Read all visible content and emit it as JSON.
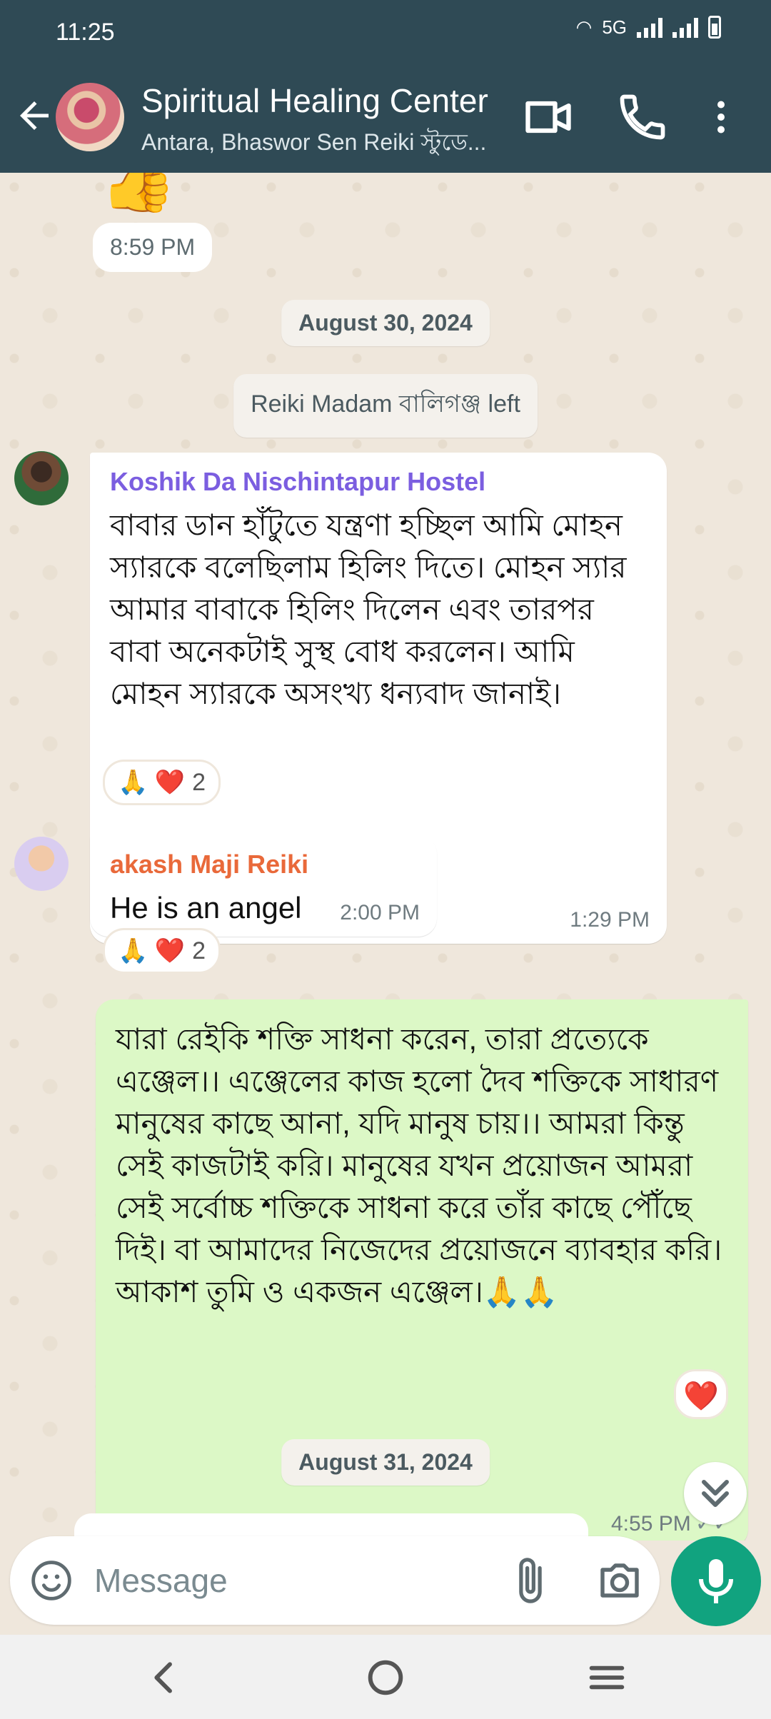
{
  "status_bar": {
    "time": "11:25",
    "network": "5G"
  },
  "header": {
    "title": "Spiritual Healing Center",
    "subtitle": "Antara, Bhaswor Sen Reiki স্টুডে..."
  },
  "chat": {
    "prev_message_time": "8:59 PM",
    "date_1": "August 30, 2024",
    "system_event": "Reiki Madam বালিগঞ্জ left",
    "messages": [
      {
        "sender": "Koshik Da Nischintapur Hostel",
        "text": "বাবার ডান হাঁটুতে যন্ত্রণা হচ্ছিল আমি মোহন স্যারকে বলেছিলাম  হিলিং দিতে। মোহন স্যার আমার  বাবাকে হিলিং দিলেন এবং তারপর বাবা অনেকটাই সুস্থ বোধ করলেন। আমি মোহন স্যারকে অসংখ্য ধন্যবাদ জানাই।",
        "time": "1:29 PM",
        "reactions": "🙏 ❤️",
        "reaction_count": "2"
      },
      {
        "sender": "akash Maji Reiki",
        "text": "He is an angel",
        "time": "2:00 PM",
        "reactions": "🙏 ❤️",
        "reaction_count": "2"
      },
      {
        "text": "যারা রেইকি শক্তি সাধনা করেন, তারা প্রত্যেকে এঞ্জেল।। এঞ্জেলের কাজ হলো দৈব শক্তিকে সাধারণ মানুষের কাছে আনা, যদি মানুষ চায়।। আমরা কিন্তু সেই কাজটাই করি। মানুষের যখন প্রয়োজন আমরা সেই সর্বোচ্চ শক্তিকে সাধনা করে তাঁর কাছে পৌঁছে দিই। বা আমাদের নিজেদের প্রয়োজনে ব্যাবহার করি। আকাশ তুমি ও একজন এঞ্জেল।🙏🙏",
        "time": "4:55 PM",
        "reaction": "❤️"
      }
    ],
    "date_2": "August 31, 2024"
  },
  "composer": {
    "placeholder": "Message"
  },
  "icons": {
    "back": "arrow-left",
    "video": "video-camera",
    "call": "phone",
    "more": "vertical-dots",
    "emoji": "smiley",
    "attach": "paperclip",
    "camera": "camera",
    "mic": "microphone",
    "scroll": "double-chevron-down"
  },
  "colors": {
    "header": "#2f4a55",
    "outgoing_bubble": "#dcf8c6",
    "mic_button": "#11a37f",
    "sender_1": "#7b5ee0",
    "sender_2": "#e9693a"
  }
}
